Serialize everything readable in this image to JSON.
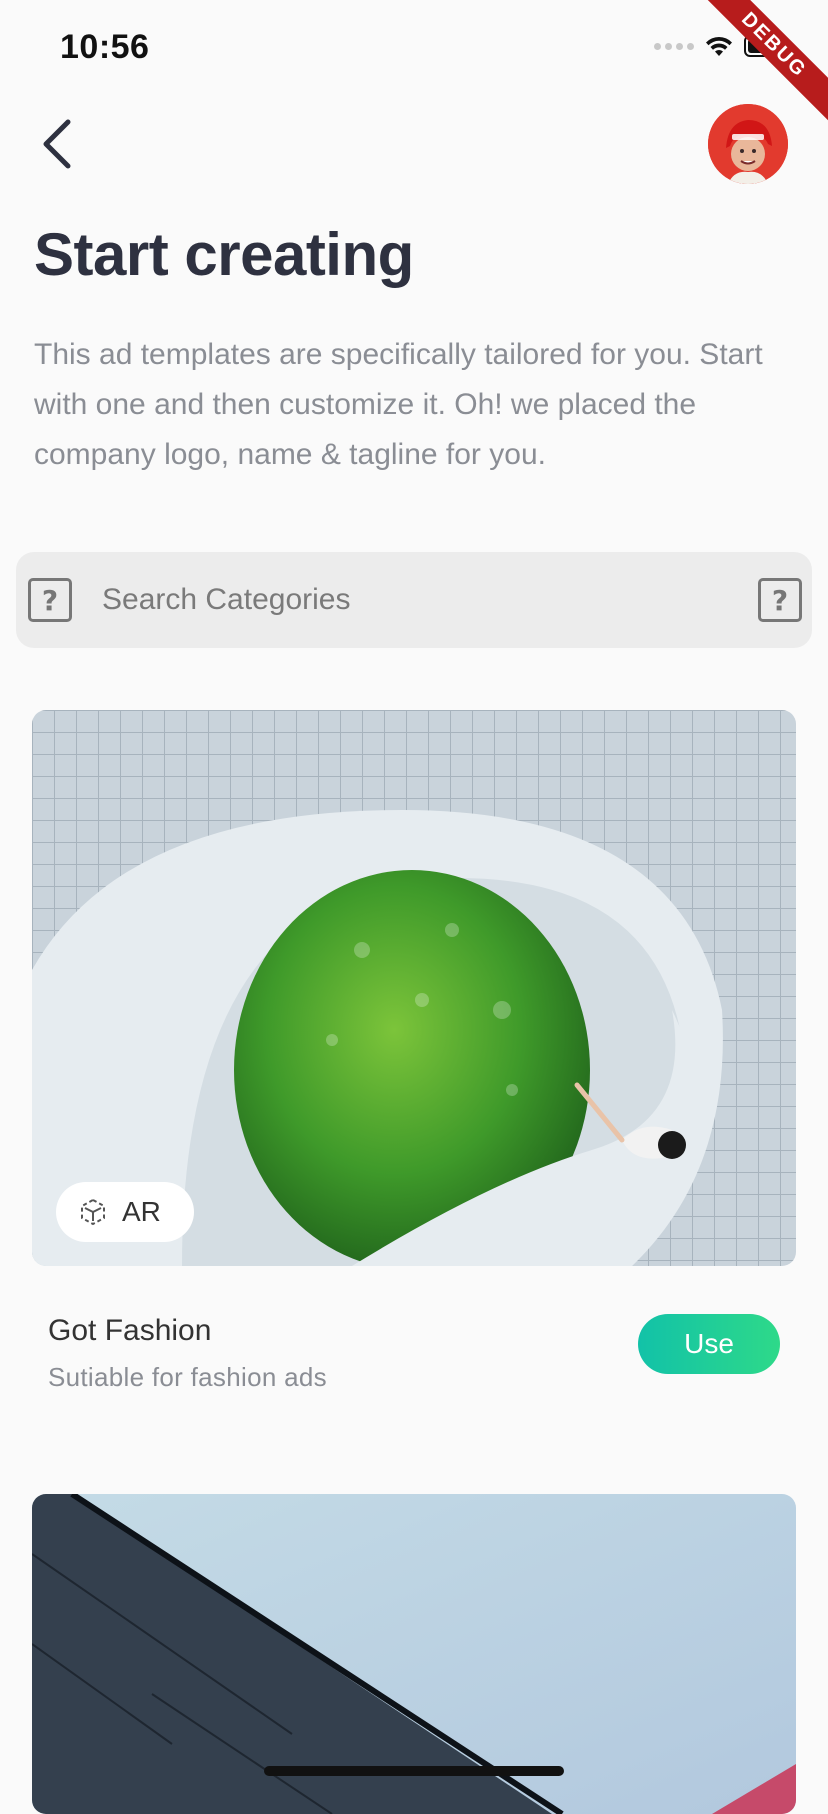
{
  "status_bar": {
    "time": "10:56",
    "icons": [
      "signal-icon",
      "wifi-icon",
      "battery-icon"
    ]
  },
  "debug_banner": "DEBUG",
  "header": {
    "back_icon": "chevron-left-icon",
    "avatar": "user-avatar"
  },
  "page": {
    "title": "Start creating",
    "description": "This ad templates are specifically tailored for you. Start with one and then customize it. Oh! we placed the company logo, name & tagline for you."
  },
  "search": {
    "placeholder": "Search Categories",
    "left_icon": "help-box-icon",
    "right_icon": "help-box-icon"
  },
  "templates": [
    {
      "image": "spiral-staircase-with-plants",
      "badge": {
        "icon": "ar-cube-icon",
        "label": "AR"
      },
      "title": "Got Fashion",
      "subtitle": "Sutiable for fashion ads",
      "action_label": "Use"
    },
    {
      "image": "building-against-sky"
    }
  ],
  "colors": {
    "accent_start": "#12c2a8",
    "accent_end": "#2ed989",
    "title": "#2e3140",
    "muted": "#8a8d94"
  }
}
